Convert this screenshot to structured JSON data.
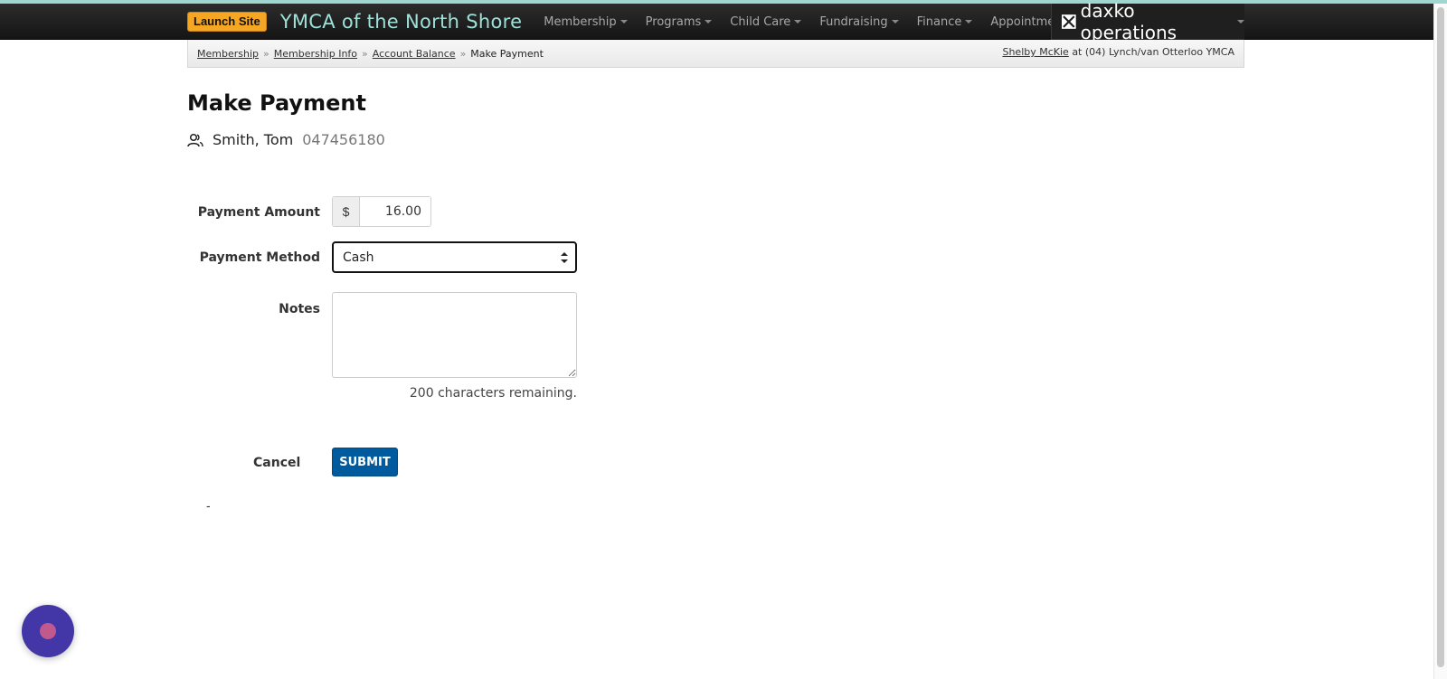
{
  "navbar": {
    "launch_label": "Launch Site",
    "org_title": "YMCA of the North Shore",
    "menu": [
      {
        "label": "Membership"
      },
      {
        "label": "Programs"
      },
      {
        "label": "Child Care"
      },
      {
        "label": "Fundraising"
      },
      {
        "label": "Finance"
      },
      {
        "label": "Appointments"
      }
    ],
    "brand": "daxko operations"
  },
  "breadcrumb": {
    "items": [
      "Membership",
      "Membership Info",
      "Account Balance"
    ],
    "current": "Make Payment",
    "separator": "»"
  },
  "user": {
    "name": "Shelby McKie",
    "at_text": "at (04) Lynch/van Otterloo YMCA"
  },
  "page": {
    "title": "Make Payment",
    "member_name": "Smith, Tom",
    "member_id": "047456180"
  },
  "form": {
    "payment_amount_label": "Payment Amount",
    "currency_symbol": "$",
    "payment_amount_value": "16.00",
    "payment_method_label": "Payment Method",
    "payment_method_value": "Cash",
    "notes_label": "Notes",
    "notes_value": "",
    "chars_remaining": "200 characters remaining.",
    "cancel_label": "Cancel",
    "submit_label": "SUBMIT",
    "dash": "-"
  },
  "colors": {
    "accent_teal": "#9fd6cf",
    "launch_orange": "#f5a623",
    "submit_blue": "#005a9e",
    "chat_purple": "#4337a8"
  }
}
